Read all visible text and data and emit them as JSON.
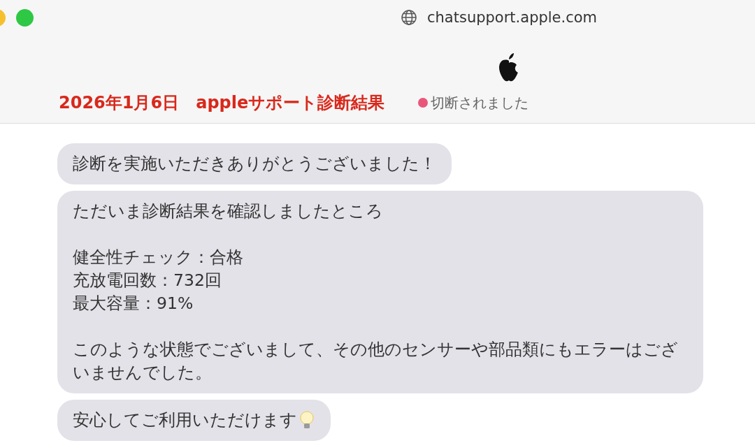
{
  "browser": {
    "url": "chatsupport.apple.com"
  },
  "header": {
    "title": "2026年1月6日　appleサポート診断結果",
    "status": {
      "text": "切断されました",
      "color": "#e8577a"
    }
  },
  "messages": [
    {
      "text": "診断を実施いただきありがとうございました！"
    },
    {
      "paragraphs": [
        [
          "ただいま診断結果を確認しましたところ"
        ],
        [
          "健全性チェック：合格",
          "充放電回数：732回",
          "最大容量：91%"
        ],
        [
          "このような状態でございまして、その他のセンサーや部品類にもエラーはございませんでした。"
        ]
      ]
    },
    {
      "text": "安心してご利用いただけます",
      "kind": "bulb"
    }
  ]
}
